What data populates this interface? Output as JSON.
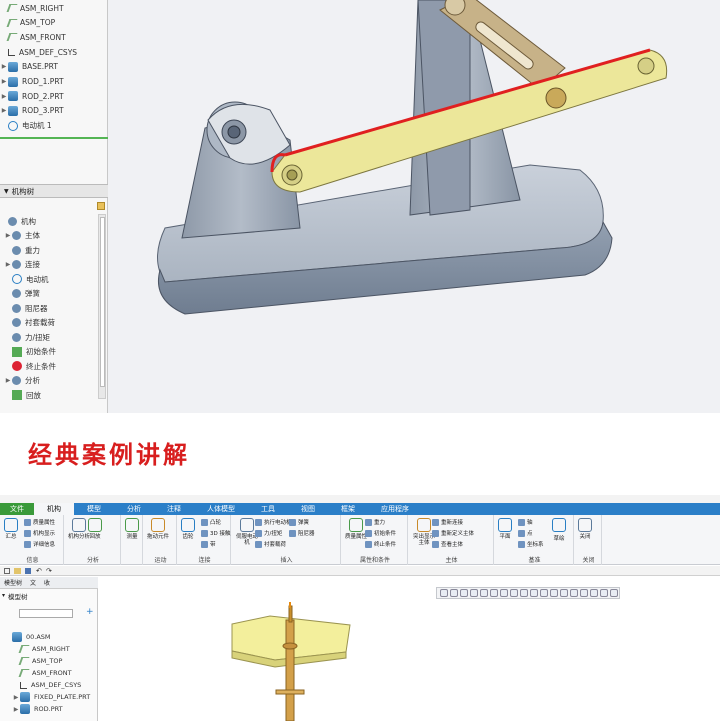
{
  "top_tree": {
    "items": [
      {
        "label": "ASM_RIGHT",
        "icon": "datum-plane-icon"
      },
      {
        "label": "ASM_TOP",
        "icon": "datum-plane-icon"
      },
      {
        "label": "ASM_FRONT",
        "icon": "datum-plane-icon"
      },
      {
        "label": "ASM_DEF_CSYS",
        "icon": "csys-icon"
      },
      {
        "label": "BASE.PRT",
        "icon": "part-icon"
      },
      {
        "label": "ROD_1.PRT",
        "icon": "part-icon"
      },
      {
        "label": "ROD_2.PRT",
        "icon": "part-icon"
      },
      {
        "label": "ROD_3.PRT",
        "icon": "part-icon"
      },
      {
        "label": "电动机 1",
        "icon": "motor-icon"
      }
    ],
    "mech_header": "机构树",
    "mech_items": [
      {
        "label": "机构",
        "icon": "mechanism-icon"
      },
      {
        "label": "主体",
        "icon": "body-icon"
      },
      {
        "label": "重力",
        "icon": "gravity-icon"
      },
      {
        "label": "连接",
        "icon": "connection-icon"
      },
      {
        "label": "电动机",
        "icon": "motor-icon"
      },
      {
        "label": "弹簧",
        "icon": "spring-icon"
      },
      {
        "label": "阻尼器",
        "icon": "damper-icon"
      },
      {
        "label": "衬套载荷",
        "icon": "bushing-icon"
      },
      {
        "label": "力/扭矩",
        "icon": "force-icon"
      },
      {
        "label": "初始条件",
        "icon": "initial-condition-icon"
      },
      {
        "label": "终止条件",
        "icon": "termination-icon"
      },
      {
        "label": "分析",
        "icon": "analysis-icon"
      },
      {
        "label": "回放",
        "icon": "playback-icon"
      }
    ]
  },
  "banner": {
    "title": "经典案例讲解"
  },
  "menubar": {
    "items": [
      "文件",
      "机构",
      "模型",
      "分析",
      "注释",
      "人体模型",
      "工具",
      "视图",
      "框架",
      "应用程序"
    ]
  },
  "ribbon": {
    "groups": [
      {
        "label": "信息",
        "buttons": [
          "汇总"
        ],
        "small": [
          "质量属性",
          "机构显示",
          "详细信息"
        ]
      },
      {
        "label": "分析",
        "buttons": [
          "机构分析",
          "回放"
        ]
      },
      {
        "label": "",
        "buttons": [
          "测量"
        ]
      },
      {
        "label": "运动",
        "buttons": [
          "拖动元件"
        ]
      },
      {
        "label": "连接",
        "buttons": [
          "齿轮"
        ],
        "small": [
          "凸轮",
          "3D 接触",
          "带"
        ]
      },
      {
        "label": "插入",
        "buttons": [
          "伺服电动机"
        ],
        "small": [
          "执行电动机",
          "力/扭矩",
          "衬套载荷",
          "弹簧",
          "阻尼器"
        ]
      },
      {
        "label": "属性和条件",
        "buttons": [
          "质量属性"
        ],
        "small": [
          "重力",
          "初始条件",
          "终止条件"
        ]
      },
      {
        "label": "主体",
        "buttons": [
          "突出显示主体"
        ],
        "small": [
          "重新连接",
          "重新定义主体",
          "查看主体"
        ]
      },
      {
        "label": "基准",
        "buttons": [
          "平面"
        ],
        "small": [
          "轴",
          "点",
          "坐标系"
        ],
        "extra": [
          "草绘"
        ]
      },
      {
        "label": "关闭",
        "buttons": [
          "关闭"
        ]
      }
    ]
  },
  "left_panel": {
    "tabs": [
      "模型树",
      "文",
      "收"
    ],
    "model_tree_label": "模型树",
    "items": [
      {
        "label": "00.ASM",
        "icon": "assembly-icon"
      },
      {
        "label": "ASM_RIGHT",
        "icon": "datum-plane-icon"
      },
      {
        "label": "ASM_TOP",
        "icon": "datum-plane-icon"
      },
      {
        "label": "ASM_FRONT",
        "icon": "datum-plane-icon"
      },
      {
        "label": "ASM_DEF_CSYS",
        "icon": "csys-icon"
      },
      {
        "label": "FIXED_PLATE.PRT",
        "icon": "part-icon"
      },
      {
        "label": "ROD.PRT",
        "icon": "part-icon"
      }
    ]
  },
  "colors": {
    "ribbon_blue": "#2b7fc8",
    "file_green": "#3a9a3a",
    "banner_red": "#d81e1e",
    "rod_yellow": "#ece79a",
    "rod_edge_red": "#e02020"
  }
}
